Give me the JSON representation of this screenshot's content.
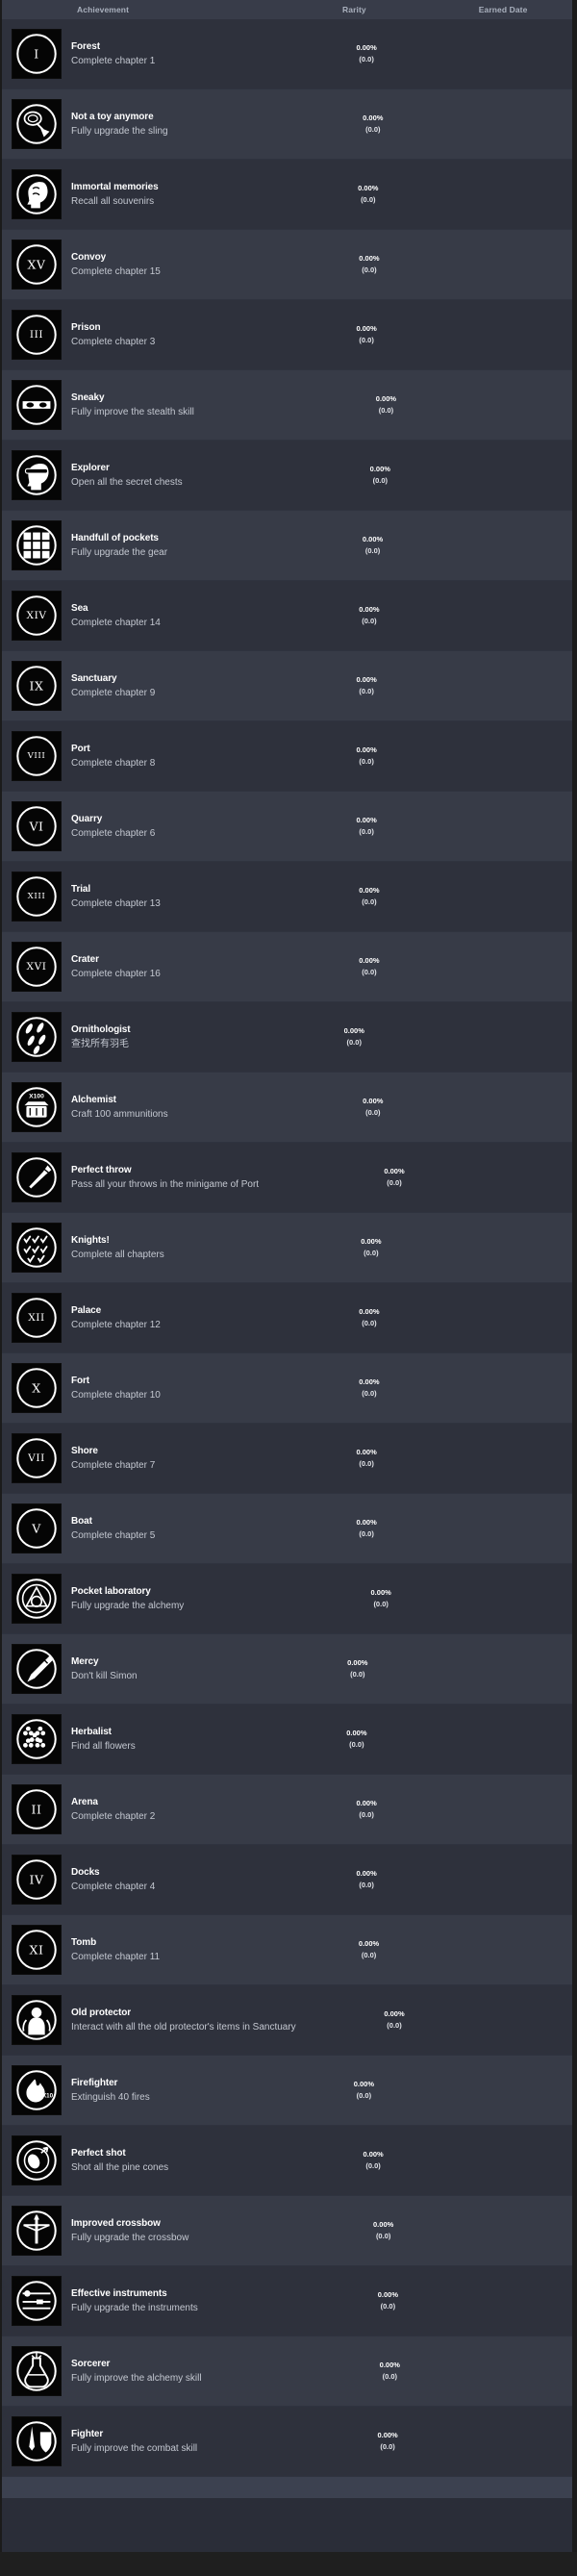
{
  "header": {
    "achievement": "Achievement",
    "rarity": "Rarity",
    "earned_date": "Earned Date"
  },
  "colors": {
    "page_bg": "#1b1b1b",
    "panel_bg": "#2a2d38",
    "header_bg": "#383c49",
    "row_odd": "#2e313c",
    "row_even": "#373b47",
    "title_text": "#ffffff",
    "desc_text": "#c4c8d1",
    "header_text": "#a9b0bd",
    "icon_bg": "#050505",
    "icon_fg": "#ffffff"
  },
  "achievements": [
    {
      "title": "Forest",
      "desc": "Complete chapter 1",
      "rarity_pct": "0.00%",
      "rarity_count": "(0.0)",
      "earned_date": "",
      "icon": "roman-numeral-i-icon",
      "glyph": "I"
    },
    {
      "title": "Not a toy anymore",
      "desc": "Fully upgrade the sling",
      "rarity_pct": "0.00%",
      "rarity_count": "(0.0)",
      "earned_date": "",
      "icon": "slingshot-icon",
      "glyph": ""
    },
    {
      "title": "Immortal memories",
      "desc": "Recall all souvenirs",
      "rarity_pct": "0.00%",
      "rarity_count": "(0.0)",
      "earned_date": "",
      "icon": "head-brain-icon",
      "glyph": ""
    },
    {
      "title": "Convoy",
      "desc": "Complete chapter 15",
      "rarity_pct": "0.00%",
      "rarity_count": "(0.0)",
      "earned_date": "",
      "icon": "roman-numeral-xv-icon",
      "glyph": "XV"
    },
    {
      "title": "Prison",
      "desc": "Complete chapter 3",
      "rarity_pct": "0.00%",
      "rarity_count": "(0.0)",
      "earned_date": "",
      "icon": "roman-numeral-iii-icon",
      "glyph": "III"
    },
    {
      "title": "Sneaky",
      "desc": "Fully improve the stealth skill",
      "rarity_pct": "0.00%",
      "rarity_count": "(0.0)",
      "earned_date": "",
      "icon": "bandit-mask-icon",
      "glyph": ""
    },
    {
      "title": "Explorer",
      "desc": "Open all the secret chests",
      "rarity_pct": "0.00%",
      "rarity_count": "(0.0)",
      "earned_date": "",
      "icon": "head-goggles-icon",
      "glyph": ""
    },
    {
      "title": "Handfull of pockets",
      "desc": "Fully upgrade the gear",
      "rarity_pct": "0.00%",
      "rarity_count": "(0.0)",
      "earned_date": "",
      "icon": "pockets-grid-icon",
      "glyph": ""
    },
    {
      "title": "Sea",
      "desc": "Complete chapter 14",
      "rarity_pct": "0.00%",
      "rarity_count": "(0.0)",
      "earned_date": "",
      "icon": "roman-numeral-xiv-icon",
      "glyph": "XIV"
    },
    {
      "title": "Sanctuary",
      "desc": "Complete chapter 9",
      "rarity_pct": "0.00%",
      "rarity_count": "(0.0)",
      "earned_date": "",
      "icon": "roman-numeral-ix-icon",
      "glyph": "IX"
    },
    {
      "title": "Port",
      "desc": "Complete chapter 8",
      "rarity_pct": "0.00%",
      "rarity_count": "(0.0)",
      "earned_date": "",
      "icon": "roman-numeral-viii-icon",
      "glyph": "VIII"
    },
    {
      "title": "Quarry",
      "desc": "Complete chapter 6",
      "rarity_pct": "0.00%",
      "rarity_count": "(0.0)",
      "earned_date": "",
      "icon": "roman-numeral-vi-icon",
      "glyph": "VI"
    },
    {
      "title": "Trial",
      "desc": "Complete chapter 13",
      "rarity_pct": "0.00%",
      "rarity_count": "(0.0)",
      "earned_date": "",
      "icon": "roman-numeral-xiii-icon",
      "glyph": "XIII"
    },
    {
      "title": "Crater",
      "desc": "Complete chapter 16",
      "rarity_pct": "0.00%",
      "rarity_count": "(0.0)",
      "earned_date": "",
      "icon": "roman-numeral-xvi-icon",
      "glyph": "XVI"
    },
    {
      "title": "Ornithologist",
      "desc": "查找所有羽毛",
      "rarity_pct": "0.00%",
      "rarity_count": "(0.0)",
      "earned_date": "",
      "icon": "feathers-icon",
      "glyph": ""
    },
    {
      "title": "Alchemist",
      "desc": "Craft 100 ammunitions",
      "rarity_pct": "0.00%",
      "rarity_count": "(0.0)",
      "earned_date": "",
      "icon": "ammo-crate-x100-icon",
      "glyph": "X100"
    },
    {
      "title": "Perfect throw",
      "desc": "Pass all your throws in the minigame of Port",
      "rarity_pct": "0.00%",
      "rarity_count": "(0.0)",
      "earned_date": "",
      "icon": "throwing-knife-icon",
      "glyph": ""
    },
    {
      "title": "Knights!",
      "desc": "Complete all chapters",
      "rarity_pct": "0.00%",
      "rarity_count": "(0.0)",
      "earned_date": "",
      "icon": "checkmarks-grid-icon",
      "glyph": ""
    },
    {
      "title": "Palace",
      "desc": "Complete chapter 12",
      "rarity_pct": "0.00%",
      "rarity_count": "(0.0)",
      "earned_date": "",
      "icon": "roman-numeral-xii-icon",
      "glyph": "XII"
    },
    {
      "title": "Fort",
      "desc": "Complete chapter 10",
      "rarity_pct": "0.00%",
      "rarity_count": "(0.0)",
      "earned_date": "",
      "icon": "roman-numeral-x-icon",
      "glyph": "X"
    },
    {
      "title": "Shore",
      "desc": "Complete chapter 7",
      "rarity_pct": "0.00%",
      "rarity_count": "(0.0)",
      "earned_date": "",
      "icon": "roman-numeral-vii-icon",
      "glyph": "VII"
    },
    {
      "title": "Boat",
      "desc": "Complete chapter 5",
      "rarity_pct": "0.00%",
      "rarity_count": "(0.0)",
      "earned_date": "",
      "icon": "roman-numeral-v-icon",
      "glyph": "V"
    },
    {
      "title": "Pocket laboratory",
      "desc": "Fully upgrade the alchemy",
      "rarity_pct": "0.00%",
      "rarity_count": "(0.0)",
      "earned_date": "",
      "icon": "alchemy-triangle-icon",
      "glyph": ""
    },
    {
      "title": "Mercy",
      "desc": "Don't kill Simon",
      "rarity_pct": "0.00%",
      "rarity_count": "(0.0)",
      "earned_date": "",
      "icon": "dagger-icon",
      "glyph": ""
    },
    {
      "title": "Herbalist",
      "desc": "Find all flowers",
      "rarity_pct": "0.00%",
      "rarity_count": "(0.0)",
      "earned_date": "",
      "icon": "flowers-grid-icon",
      "glyph": ""
    },
    {
      "title": "Arena",
      "desc": "Complete chapter 2",
      "rarity_pct": "0.00%",
      "rarity_count": "(0.0)",
      "earned_date": "",
      "icon": "roman-numeral-ii-icon",
      "glyph": "II"
    },
    {
      "title": "Docks",
      "desc": "Complete chapter 4",
      "rarity_pct": "0.00%",
      "rarity_count": "(0.0)",
      "earned_date": "",
      "icon": "roman-numeral-iv-icon",
      "glyph": "IV"
    },
    {
      "title": "Tomb",
      "desc": "Complete chapter 11",
      "rarity_pct": "0.00%",
      "rarity_count": "(0.0)",
      "earned_date": "",
      "icon": "roman-numeral-xi-icon",
      "glyph": "XI"
    },
    {
      "title": "Old protector",
      "desc": "Interact with all the old protector's items in Sanctuary",
      "rarity_pct": "0.00%",
      "rarity_count": "(0.0)",
      "earned_date": "",
      "icon": "ghost-figure-icon",
      "glyph": ""
    },
    {
      "title": "Firefighter",
      "desc": "Extinguish 40 fires",
      "rarity_pct": "0.00%",
      "rarity_count": "(0.0)",
      "earned_date": "",
      "icon": "fire-x10-icon",
      "glyph": "X10"
    },
    {
      "title": "Perfect shot",
      "desc": "Shot all the pine cones",
      "rarity_pct": "0.00%",
      "rarity_count": "(0.0)",
      "earned_date": "",
      "icon": "pine-cone-target-icon",
      "glyph": ""
    },
    {
      "title": "Improved crossbow",
      "desc": "Fully upgrade the crossbow",
      "rarity_pct": "0.00%",
      "rarity_count": "(0.0)",
      "earned_date": "",
      "icon": "crossbow-icon",
      "glyph": ""
    },
    {
      "title": "Effective instruments",
      "desc": "Fully upgrade the instruments",
      "rarity_pct": "0.00%",
      "rarity_count": "(0.0)",
      "earned_date": "",
      "icon": "tools-icon",
      "glyph": ""
    },
    {
      "title": "Sorcerer",
      "desc": "Fully improve the alchemy skill",
      "rarity_pct": "0.00%",
      "rarity_count": "(0.0)",
      "earned_date": "",
      "icon": "potion-flask-icon",
      "glyph": ""
    },
    {
      "title": "Fighter",
      "desc": "Fully improve the combat skill",
      "rarity_pct": "0.00%",
      "rarity_count": "(0.0)",
      "earned_date": "",
      "icon": "sword-shield-icon",
      "glyph": ""
    }
  ]
}
